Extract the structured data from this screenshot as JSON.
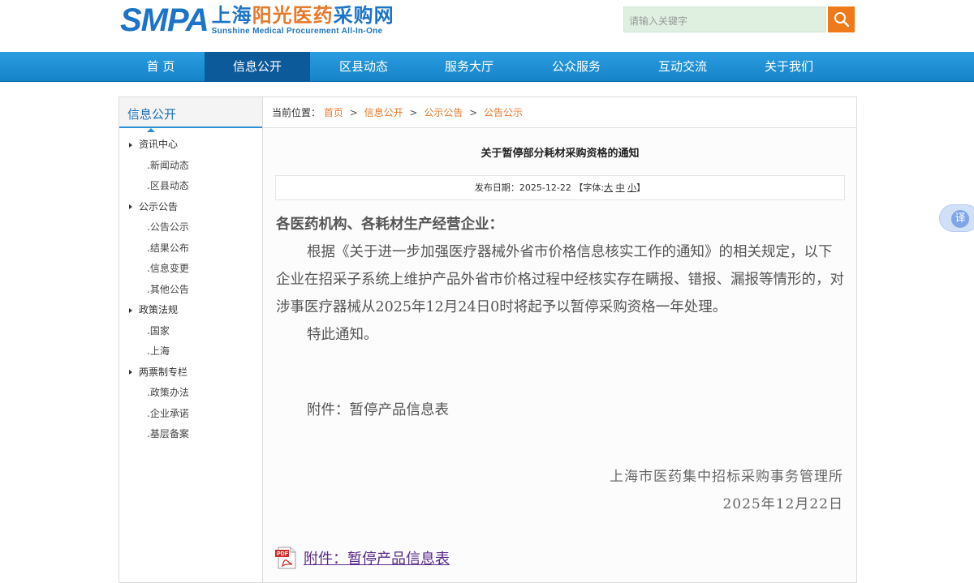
{
  "logo": {
    "abbr": "SMPA",
    "cn_part1": "上海",
    "cn_part2": "阳光医药",
    "cn_part3": "采购网",
    "en": "Sunshine Medical Procurement All-In-One"
  },
  "search": {
    "placeholder": "请输入关键字",
    "icon": "search-icon"
  },
  "nav": {
    "items": [
      "首 页",
      "信息公开",
      "区县动态",
      "服务大厅",
      "公众服务",
      "互动交流",
      "关于我们"
    ],
    "active_index": 1
  },
  "sidebar": {
    "title": "信息公开",
    "sections": [
      {
        "label": "资讯中心",
        "children": [
          ".新闻动态",
          ".区县动态"
        ]
      },
      {
        "label": "公示公告",
        "children": [
          ".公告公示",
          ".结果公布",
          ".信息变更",
          ".其他公告"
        ]
      },
      {
        "label": "政策法规",
        "children": [
          ".国家",
          ".上海"
        ]
      },
      {
        "label": "两票制专栏",
        "children": [
          ".政策办法",
          ".企业承诺",
          ".基层备案"
        ]
      }
    ]
  },
  "breadcrumb": {
    "prefix": "当前位置：",
    "items": [
      "首页",
      "信息公开",
      "公示公告",
      "公告公示"
    ],
    "separator": ">"
  },
  "article": {
    "title": "关于暂停部分耗材采购资格的通知",
    "meta_prefix": "发布日期：2025-12-22 【字体:",
    "font_large": "大",
    "font_medium": "中",
    "font_small": "小",
    "meta_suffix": "】",
    "greeting": "各医药机构、各耗材生产经营企业：",
    "paragraph1": "根据《关于进一步加强医疗器械外省市价格信息核实工作的通知》的相关规定，以下企业在招采子系统上维护产品外省市价格过程中经核实存在瞒报、错报、漏报等情形的，对涉事医疗器械从2025年12月24日0时将起予以暂停采购资格一年处理。",
    "paragraph2": "特此通知。",
    "attachment_line": "附件：暂停产品信息表",
    "signature_org": "上海市医药集中招标采购事务管理所",
    "signature_date": "2025年12月22日",
    "attachment_link": "附件：暂停产品信息表"
  },
  "translate_widget": {
    "label": "译"
  },
  "colors": {
    "brand_blue": "#1b74c8",
    "accent_orange": "#e8782a",
    "nav_active": "#0d5a9a"
  }
}
